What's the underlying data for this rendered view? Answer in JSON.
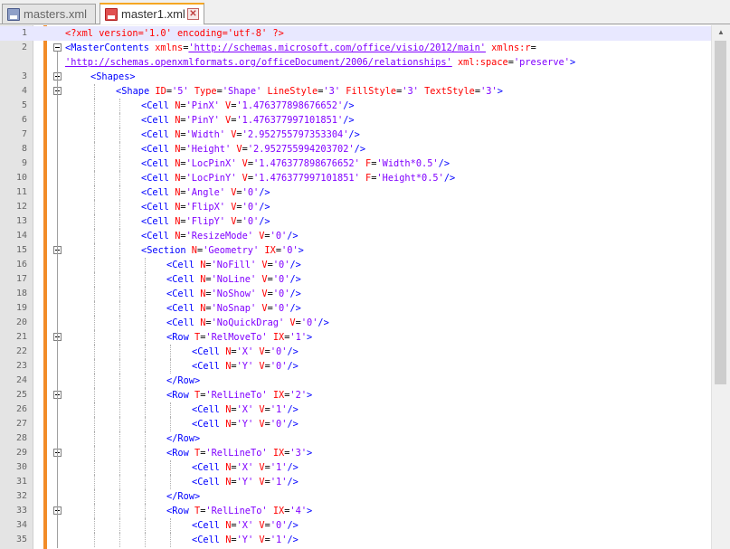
{
  "tabs": [
    {
      "label": "masters.xml",
      "active": false
    },
    {
      "label": "master1.xml",
      "active": true
    }
  ],
  "current_line": 1,
  "lines": [
    {
      "n": 1,
      "indent": 0,
      "fold": "",
      "parts": [
        [
          "pi",
          "<?xml version='1.0' encoding='utf-8' ?>"
        ]
      ]
    },
    {
      "n": 2,
      "indent": 0,
      "fold": "open",
      "parts": [
        [
          "tag",
          "<MasterContents "
        ],
        [
          "attr",
          "xmlns"
        ],
        [
          "eq",
          "="
        ],
        [
          "url",
          "'http://schemas.microsoft.com/office/visio/2012/main'"
        ],
        [
          "eq",
          " "
        ],
        [
          "attr",
          "xmlns:r"
        ],
        [
          "eq",
          "="
        ]
      ]
    },
    {
      "n": null,
      "indent": 0,
      "fold": "",
      "parts": [
        [
          "url",
          "'http://schemas.openxmlformats.org/officeDocument/2006/relationships'"
        ],
        [
          "eq",
          " "
        ],
        [
          "attr",
          "xml:space"
        ],
        [
          "eq",
          "="
        ],
        [
          "val",
          "'preserve'"
        ],
        [
          "tag",
          ">"
        ]
      ]
    },
    {
      "n": 3,
      "indent": 1,
      "fold": "open",
      "parts": [
        [
          "tag",
          "<Shapes>"
        ]
      ]
    },
    {
      "n": 4,
      "indent": 2,
      "fold": "open",
      "parts": [
        [
          "tag",
          "<Shape "
        ],
        [
          "attr",
          "ID"
        ],
        [
          "eq",
          "="
        ],
        [
          "val",
          "'5'"
        ],
        [
          "eq",
          " "
        ],
        [
          "attr",
          "Type"
        ],
        [
          "eq",
          "="
        ],
        [
          "val",
          "'Shape'"
        ],
        [
          "eq",
          " "
        ],
        [
          "attr",
          "LineStyle"
        ],
        [
          "eq",
          "="
        ],
        [
          "val",
          "'3'"
        ],
        [
          "eq",
          " "
        ],
        [
          "attr",
          "FillStyle"
        ],
        [
          "eq",
          "="
        ],
        [
          "val",
          "'3'"
        ],
        [
          "eq",
          " "
        ],
        [
          "attr",
          "TextStyle"
        ],
        [
          "eq",
          "="
        ],
        [
          "val",
          "'3'"
        ],
        [
          "tag",
          ">"
        ]
      ]
    },
    {
      "n": 5,
      "indent": 3,
      "fold": "",
      "parts": [
        [
          "tag",
          "<Cell "
        ],
        [
          "attr",
          "N"
        ],
        [
          "eq",
          "="
        ],
        [
          "val",
          "'PinX'"
        ],
        [
          "eq",
          " "
        ],
        [
          "attr",
          "V"
        ],
        [
          "eq",
          "="
        ],
        [
          "val",
          "'1.476377898676652'"
        ],
        [
          "tag",
          "/>"
        ]
      ]
    },
    {
      "n": 6,
      "indent": 3,
      "fold": "",
      "parts": [
        [
          "tag",
          "<Cell "
        ],
        [
          "attr",
          "N"
        ],
        [
          "eq",
          "="
        ],
        [
          "val",
          "'PinY'"
        ],
        [
          "eq",
          " "
        ],
        [
          "attr",
          "V"
        ],
        [
          "eq",
          "="
        ],
        [
          "val",
          "'1.476377997101851'"
        ],
        [
          "tag",
          "/>"
        ]
      ]
    },
    {
      "n": 7,
      "indent": 3,
      "fold": "",
      "parts": [
        [
          "tag",
          "<Cell "
        ],
        [
          "attr",
          "N"
        ],
        [
          "eq",
          "="
        ],
        [
          "val",
          "'Width'"
        ],
        [
          "eq",
          " "
        ],
        [
          "attr",
          "V"
        ],
        [
          "eq",
          "="
        ],
        [
          "val",
          "'2.952755797353304'"
        ],
        [
          "tag",
          "/>"
        ]
      ]
    },
    {
      "n": 8,
      "indent": 3,
      "fold": "",
      "parts": [
        [
          "tag",
          "<Cell "
        ],
        [
          "attr",
          "N"
        ],
        [
          "eq",
          "="
        ],
        [
          "val",
          "'Height'"
        ],
        [
          "eq",
          " "
        ],
        [
          "attr",
          "V"
        ],
        [
          "eq",
          "="
        ],
        [
          "val",
          "'2.952755994203702'"
        ],
        [
          "tag",
          "/>"
        ]
      ]
    },
    {
      "n": 9,
      "indent": 3,
      "fold": "",
      "parts": [
        [
          "tag",
          "<Cell "
        ],
        [
          "attr",
          "N"
        ],
        [
          "eq",
          "="
        ],
        [
          "val",
          "'LocPinX'"
        ],
        [
          "eq",
          " "
        ],
        [
          "attr",
          "V"
        ],
        [
          "eq",
          "="
        ],
        [
          "val",
          "'1.476377898676652'"
        ],
        [
          "eq",
          " "
        ],
        [
          "attr",
          "F"
        ],
        [
          "eq",
          "="
        ],
        [
          "val",
          "'Width*0.5'"
        ],
        [
          "tag",
          "/>"
        ]
      ]
    },
    {
      "n": 10,
      "indent": 3,
      "fold": "",
      "parts": [
        [
          "tag",
          "<Cell "
        ],
        [
          "attr",
          "N"
        ],
        [
          "eq",
          "="
        ],
        [
          "val",
          "'LocPinY'"
        ],
        [
          "eq",
          " "
        ],
        [
          "attr",
          "V"
        ],
        [
          "eq",
          "="
        ],
        [
          "val",
          "'1.476377997101851'"
        ],
        [
          "eq",
          " "
        ],
        [
          "attr",
          "F"
        ],
        [
          "eq",
          "="
        ],
        [
          "val",
          "'Height*0.5'"
        ],
        [
          "tag",
          "/>"
        ]
      ]
    },
    {
      "n": 11,
      "indent": 3,
      "fold": "",
      "parts": [
        [
          "tag",
          "<Cell "
        ],
        [
          "attr",
          "N"
        ],
        [
          "eq",
          "="
        ],
        [
          "val",
          "'Angle'"
        ],
        [
          "eq",
          " "
        ],
        [
          "attr",
          "V"
        ],
        [
          "eq",
          "="
        ],
        [
          "val",
          "'0'"
        ],
        [
          "tag",
          "/>"
        ]
      ]
    },
    {
      "n": 12,
      "indent": 3,
      "fold": "",
      "parts": [
        [
          "tag",
          "<Cell "
        ],
        [
          "attr",
          "N"
        ],
        [
          "eq",
          "="
        ],
        [
          "val",
          "'FlipX'"
        ],
        [
          "eq",
          " "
        ],
        [
          "attr",
          "V"
        ],
        [
          "eq",
          "="
        ],
        [
          "val",
          "'0'"
        ],
        [
          "tag",
          "/>"
        ]
      ]
    },
    {
      "n": 13,
      "indent": 3,
      "fold": "",
      "parts": [
        [
          "tag",
          "<Cell "
        ],
        [
          "attr",
          "N"
        ],
        [
          "eq",
          "="
        ],
        [
          "val",
          "'FlipY'"
        ],
        [
          "eq",
          " "
        ],
        [
          "attr",
          "V"
        ],
        [
          "eq",
          "="
        ],
        [
          "val",
          "'0'"
        ],
        [
          "tag",
          "/>"
        ]
      ]
    },
    {
      "n": 14,
      "indent": 3,
      "fold": "",
      "parts": [
        [
          "tag",
          "<Cell "
        ],
        [
          "attr",
          "N"
        ],
        [
          "eq",
          "="
        ],
        [
          "val",
          "'ResizeMode'"
        ],
        [
          "eq",
          " "
        ],
        [
          "attr",
          "V"
        ],
        [
          "eq",
          "="
        ],
        [
          "val",
          "'0'"
        ],
        [
          "tag",
          "/>"
        ]
      ]
    },
    {
      "n": 15,
      "indent": 3,
      "fold": "open",
      "parts": [
        [
          "tag",
          "<Section "
        ],
        [
          "attr",
          "N"
        ],
        [
          "eq",
          "="
        ],
        [
          "val",
          "'Geometry'"
        ],
        [
          "eq",
          " "
        ],
        [
          "attr",
          "IX"
        ],
        [
          "eq",
          "="
        ],
        [
          "val",
          "'0'"
        ],
        [
          "tag",
          ">"
        ]
      ]
    },
    {
      "n": 16,
      "indent": 4,
      "fold": "",
      "parts": [
        [
          "tag",
          "<Cell "
        ],
        [
          "attr",
          "N"
        ],
        [
          "eq",
          "="
        ],
        [
          "val",
          "'NoFill'"
        ],
        [
          "eq",
          " "
        ],
        [
          "attr",
          "V"
        ],
        [
          "eq",
          "="
        ],
        [
          "val",
          "'0'"
        ],
        [
          "tag",
          "/>"
        ]
      ]
    },
    {
      "n": 17,
      "indent": 4,
      "fold": "",
      "parts": [
        [
          "tag",
          "<Cell "
        ],
        [
          "attr",
          "N"
        ],
        [
          "eq",
          "="
        ],
        [
          "val",
          "'NoLine'"
        ],
        [
          "eq",
          " "
        ],
        [
          "attr",
          "V"
        ],
        [
          "eq",
          "="
        ],
        [
          "val",
          "'0'"
        ],
        [
          "tag",
          "/>"
        ]
      ]
    },
    {
      "n": 18,
      "indent": 4,
      "fold": "",
      "parts": [
        [
          "tag",
          "<Cell "
        ],
        [
          "attr",
          "N"
        ],
        [
          "eq",
          "="
        ],
        [
          "val",
          "'NoShow'"
        ],
        [
          "eq",
          " "
        ],
        [
          "attr",
          "V"
        ],
        [
          "eq",
          "="
        ],
        [
          "val",
          "'0'"
        ],
        [
          "tag",
          "/>"
        ]
      ]
    },
    {
      "n": 19,
      "indent": 4,
      "fold": "",
      "parts": [
        [
          "tag",
          "<Cell "
        ],
        [
          "attr",
          "N"
        ],
        [
          "eq",
          "="
        ],
        [
          "val",
          "'NoSnap'"
        ],
        [
          "eq",
          " "
        ],
        [
          "attr",
          "V"
        ],
        [
          "eq",
          "="
        ],
        [
          "val",
          "'0'"
        ],
        [
          "tag",
          "/>"
        ]
      ]
    },
    {
      "n": 20,
      "indent": 4,
      "fold": "",
      "parts": [
        [
          "tag",
          "<Cell "
        ],
        [
          "attr",
          "N"
        ],
        [
          "eq",
          "="
        ],
        [
          "val",
          "'NoQuickDrag'"
        ],
        [
          "eq",
          " "
        ],
        [
          "attr",
          "V"
        ],
        [
          "eq",
          "="
        ],
        [
          "val",
          "'0'"
        ],
        [
          "tag",
          "/>"
        ]
      ]
    },
    {
      "n": 21,
      "indent": 4,
      "fold": "open",
      "parts": [
        [
          "tag",
          "<Row "
        ],
        [
          "attr",
          "T"
        ],
        [
          "eq",
          "="
        ],
        [
          "val",
          "'RelMoveTo'"
        ],
        [
          "eq",
          " "
        ],
        [
          "attr",
          "IX"
        ],
        [
          "eq",
          "="
        ],
        [
          "val",
          "'1'"
        ],
        [
          "tag",
          ">"
        ]
      ]
    },
    {
      "n": 22,
      "indent": 5,
      "fold": "",
      "parts": [
        [
          "tag",
          "<Cell "
        ],
        [
          "attr",
          "N"
        ],
        [
          "eq",
          "="
        ],
        [
          "val",
          "'X'"
        ],
        [
          "eq",
          " "
        ],
        [
          "attr",
          "V"
        ],
        [
          "eq",
          "="
        ],
        [
          "val",
          "'0'"
        ],
        [
          "tag",
          "/>"
        ]
      ]
    },
    {
      "n": 23,
      "indent": 5,
      "fold": "",
      "parts": [
        [
          "tag",
          "<Cell "
        ],
        [
          "attr",
          "N"
        ],
        [
          "eq",
          "="
        ],
        [
          "val",
          "'Y'"
        ],
        [
          "eq",
          " "
        ],
        [
          "attr",
          "V"
        ],
        [
          "eq",
          "="
        ],
        [
          "val",
          "'0'"
        ],
        [
          "tag",
          "/>"
        ]
      ]
    },
    {
      "n": 24,
      "indent": 4,
      "fold": "end",
      "parts": [
        [
          "tag",
          "</Row>"
        ]
      ]
    },
    {
      "n": 25,
      "indent": 4,
      "fold": "open",
      "parts": [
        [
          "tag",
          "<Row "
        ],
        [
          "attr",
          "T"
        ],
        [
          "eq",
          "="
        ],
        [
          "val",
          "'RelLineTo'"
        ],
        [
          "eq",
          " "
        ],
        [
          "attr",
          "IX"
        ],
        [
          "eq",
          "="
        ],
        [
          "val",
          "'2'"
        ],
        [
          "tag",
          ">"
        ]
      ]
    },
    {
      "n": 26,
      "indent": 5,
      "fold": "",
      "parts": [
        [
          "tag",
          "<Cell "
        ],
        [
          "attr",
          "N"
        ],
        [
          "eq",
          "="
        ],
        [
          "val",
          "'X'"
        ],
        [
          "eq",
          " "
        ],
        [
          "attr",
          "V"
        ],
        [
          "eq",
          "="
        ],
        [
          "val",
          "'1'"
        ],
        [
          "tag",
          "/>"
        ]
      ]
    },
    {
      "n": 27,
      "indent": 5,
      "fold": "",
      "parts": [
        [
          "tag",
          "<Cell "
        ],
        [
          "attr",
          "N"
        ],
        [
          "eq",
          "="
        ],
        [
          "val",
          "'Y'"
        ],
        [
          "eq",
          " "
        ],
        [
          "attr",
          "V"
        ],
        [
          "eq",
          "="
        ],
        [
          "val",
          "'0'"
        ],
        [
          "tag",
          "/>"
        ]
      ]
    },
    {
      "n": 28,
      "indent": 4,
      "fold": "end",
      "parts": [
        [
          "tag",
          "</Row>"
        ]
      ]
    },
    {
      "n": 29,
      "indent": 4,
      "fold": "open",
      "parts": [
        [
          "tag",
          "<Row "
        ],
        [
          "attr",
          "T"
        ],
        [
          "eq",
          "="
        ],
        [
          "val",
          "'RelLineTo'"
        ],
        [
          "eq",
          " "
        ],
        [
          "attr",
          "IX"
        ],
        [
          "eq",
          "="
        ],
        [
          "val",
          "'3'"
        ],
        [
          "tag",
          ">"
        ]
      ]
    },
    {
      "n": 30,
      "indent": 5,
      "fold": "",
      "parts": [
        [
          "tag",
          "<Cell "
        ],
        [
          "attr",
          "N"
        ],
        [
          "eq",
          "="
        ],
        [
          "val",
          "'X'"
        ],
        [
          "eq",
          " "
        ],
        [
          "attr",
          "V"
        ],
        [
          "eq",
          "="
        ],
        [
          "val",
          "'1'"
        ],
        [
          "tag",
          "/>"
        ]
      ]
    },
    {
      "n": 31,
      "indent": 5,
      "fold": "",
      "parts": [
        [
          "tag",
          "<Cell "
        ],
        [
          "attr",
          "N"
        ],
        [
          "eq",
          "="
        ],
        [
          "val",
          "'Y'"
        ],
        [
          "eq",
          " "
        ],
        [
          "attr",
          "V"
        ],
        [
          "eq",
          "="
        ],
        [
          "val",
          "'1'"
        ],
        [
          "tag",
          "/>"
        ]
      ]
    },
    {
      "n": 32,
      "indent": 4,
      "fold": "end",
      "parts": [
        [
          "tag",
          "</Row>"
        ]
      ]
    },
    {
      "n": 33,
      "indent": 4,
      "fold": "open",
      "parts": [
        [
          "tag",
          "<Row "
        ],
        [
          "attr",
          "T"
        ],
        [
          "eq",
          "="
        ],
        [
          "val",
          "'RelLineTo'"
        ],
        [
          "eq",
          " "
        ],
        [
          "attr",
          "IX"
        ],
        [
          "eq",
          "="
        ],
        [
          "val",
          "'4'"
        ],
        [
          "tag",
          ">"
        ]
      ]
    },
    {
      "n": 34,
      "indent": 5,
      "fold": "",
      "parts": [
        [
          "tag",
          "<Cell "
        ],
        [
          "attr",
          "N"
        ],
        [
          "eq",
          "="
        ],
        [
          "val",
          "'X'"
        ],
        [
          "eq",
          " "
        ],
        [
          "attr",
          "V"
        ],
        [
          "eq",
          "="
        ],
        [
          "val",
          "'0'"
        ],
        [
          "tag",
          "/>"
        ]
      ]
    },
    {
      "n": 35,
      "indent": 5,
      "fold": "",
      "parts": [
        [
          "tag",
          "<Cell "
        ],
        [
          "attr",
          "N"
        ],
        [
          "eq",
          "="
        ],
        [
          "val",
          "'Y'"
        ],
        [
          "eq",
          " "
        ],
        [
          "attr",
          "V"
        ],
        [
          "eq",
          "="
        ],
        [
          "val",
          "'1'"
        ],
        [
          "tag",
          "/>"
        ]
      ]
    }
  ]
}
